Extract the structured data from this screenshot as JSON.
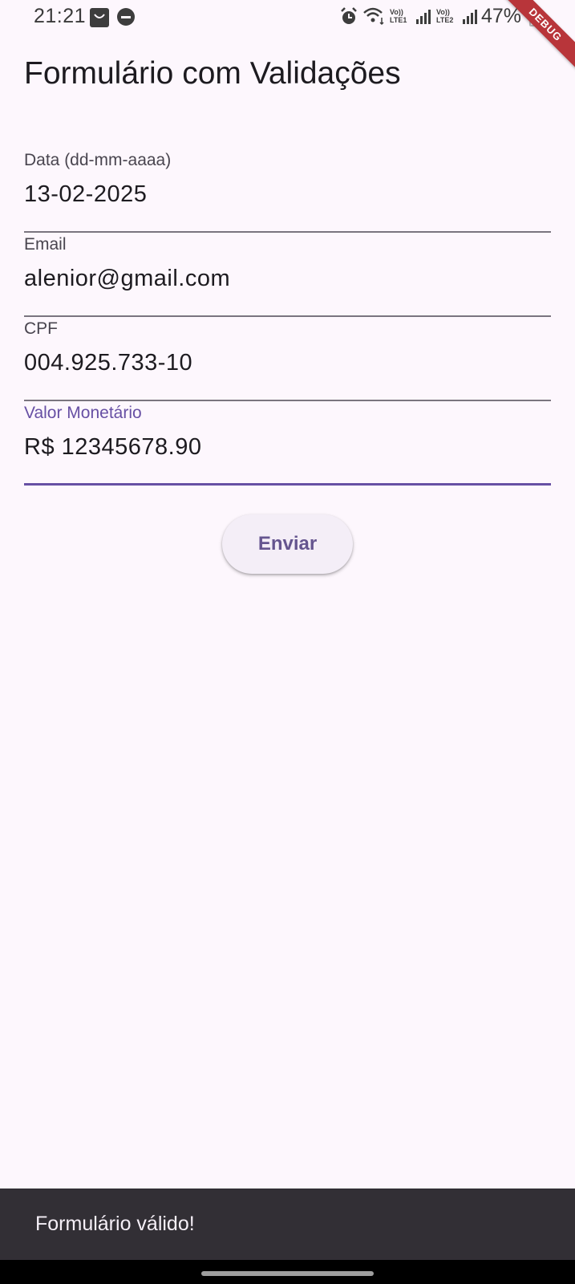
{
  "status_bar": {
    "time": "21:21",
    "battery": "47%",
    "volte1_top": "Vo))",
    "volte1_bottom": "LTE1",
    "volte2_top": "Vo))",
    "volte2_bottom": "LTE2"
  },
  "debug_banner": "DEBUG",
  "page_title": "Formulário com Validações",
  "form": {
    "fields": [
      {
        "label": "Data (dd-mm-aaaa)",
        "value": "13-02-2025"
      },
      {
        "label": "Email",
        "value": "alenior@gmail.com"
      },
      {
        "label": "CPF",
        "value": "004.925.733-10"
      },
      {
        "label": "Valor Monetário",
        "value": "R$ 12345678.90"
      }
    ],
    "submit_label": "Enviar"
  },
  "snackbar": {
    "message": "Formulário válido!"
  },
  "colors": {
    "primary": "#6750a4",
    "background": "#fdf7fd",
    "snackbar": "#322f35",
    "debug_banner": "#b8353a"
  }
}
